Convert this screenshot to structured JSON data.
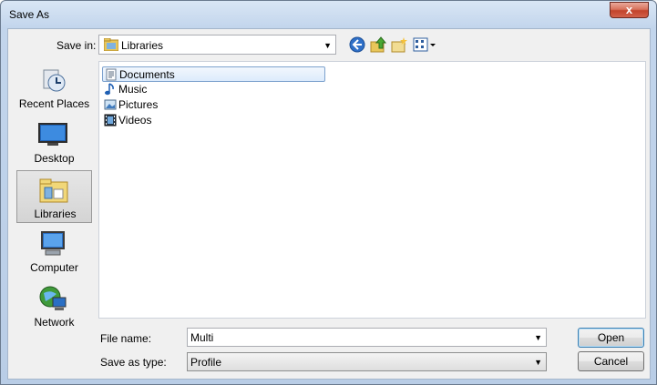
{
  "window": {
    "title": "Save As",
    "close_label": "x"
  },
  "save_in": {
    "label": "Save in:",
    "value": "Libraries"
  },
  "toolbar": {
    "icons": [
      "back-icon",
      "up-folder-icon",
      "new-folder-icon",
      "view-menu-icon"
    ]
  },
  "places": [
    {
      "label": "Recent Places",
      "icon": "recent-places-icon"
    },
    {
      "label": "Desktop",
      "icon": "desktop-icon"
    },
    {
      "label": "Libraries",
      "icon": "libraries-icon",
      "selected": true
    },
    {
      "label": "Computer",
      "icon": "computer-icon"
    },
    {
      "label": "Network",
      "icon": "network-icon"
    }
  ],
  "files": [
    {
      "label": "Documents",
      "icon": "documents-icon",
      "selected": true
    },
    {
      "label": "Music",
      "icon": "music-icon"
    },
    {
      "label": "Pictures",
      "icon": "pictures-icon"
    },
    {
      "label": "Videos",
      "icon": "videos-icon"
    }
  ],
  "file_name": {
    "label": "File name:",
    "value": "Multi"
  },
  "save_as_type": {
    "label": "Save as type:",
    "value": "Profile"
  },
  "buttons": {
    "open": "Open",
    "cancel": "Cancel"
  },
  "colors": {
    "accent": "#3c7fb1",
    "title_bar": "#c2d5ec",
    "close": "#c2432b",
    "selection": "#dcebfc"
  }
}
